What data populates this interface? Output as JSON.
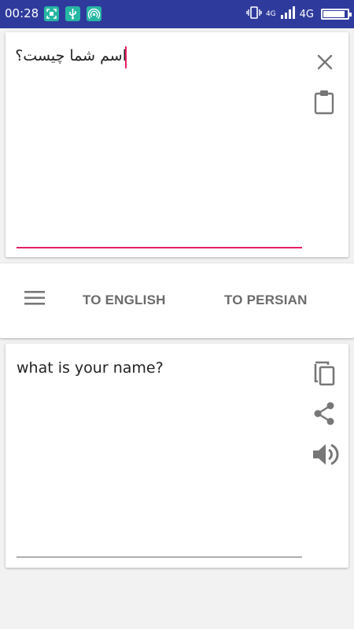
{
  "status_bar": {
    "time": "00:28",
    "network_small": "4G",
    "network": "4G",
    "battery_level": 0.9,
    "icons": [
      "screenshot-icon",
      "usb-icon",
      "hotspot-icon",
      "vibrate-icon",
      "signal-icon",
      "battery-icon"
    ]
  },
  "input": {
    "text": "اسم شما چیست؟",
    "icons": [
      "close-icon",
      "paste-icon"
    ],
    "accent_color": "#e91e63"
  },
  "tabs": {
    "menu_icon": "hamburger-icon",
    "to_english": "TO ENGLISH",
    "to_persian": "TO PERSIAN"
  },
  "output": {
    "text": "what is your name?",
    "icons": [
      "copy-icon",
      "share-icon",
      "volume-icon"
    ]
  },
  "colors": {
    "status_bar": "#2f3b9c",
    "accent": "#e91e63",
    "icon_gray": "#777777",
    "background": "#f2f2f2"
  }
}
